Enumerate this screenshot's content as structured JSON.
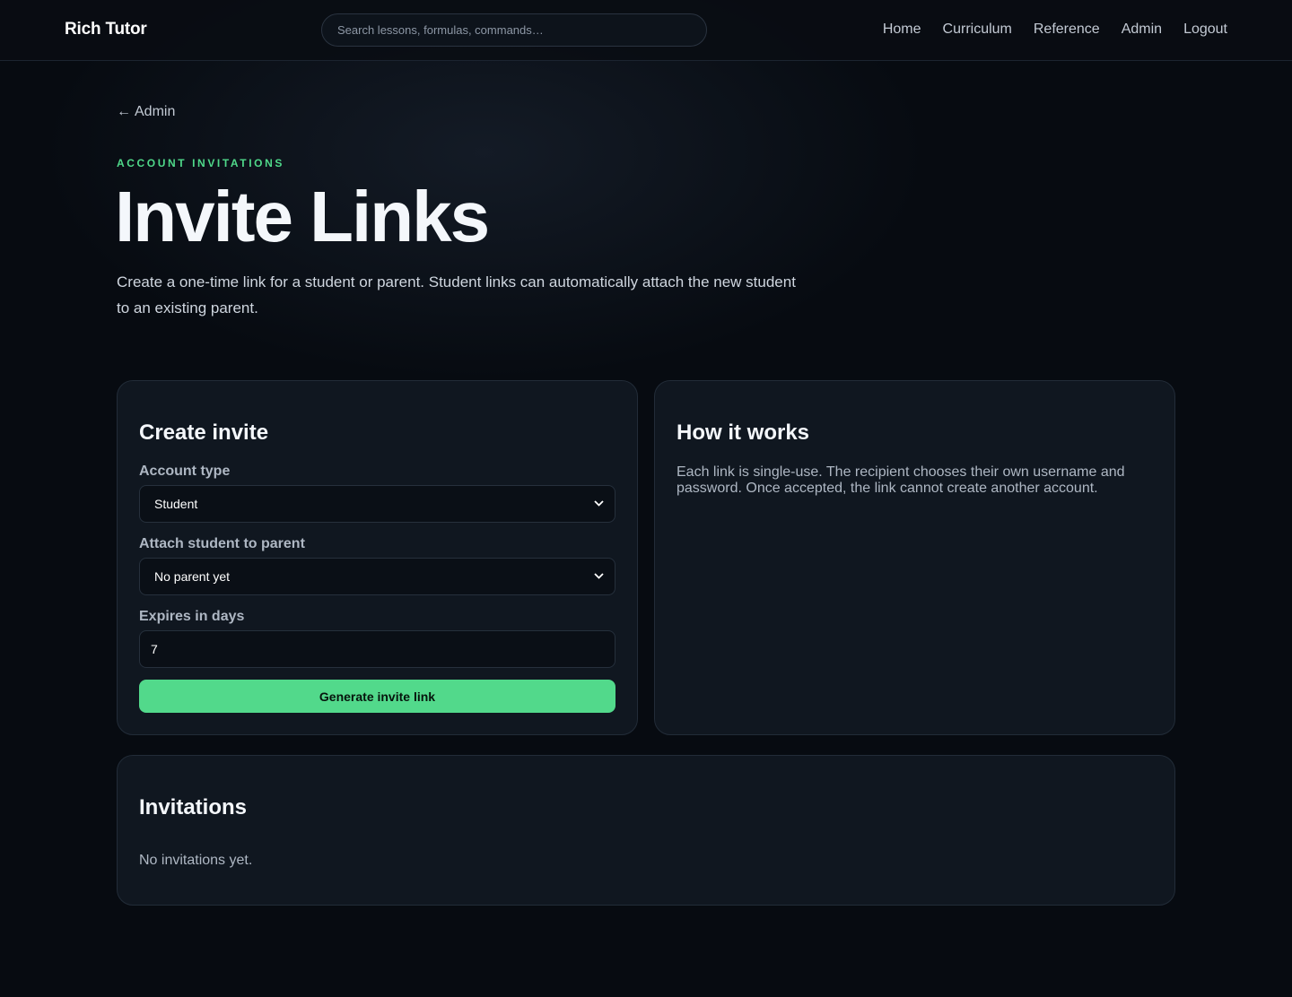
{
  "header": {
    "brand": "Rich Tutor",
    "search_placeholder": "Search lessons, formulas, commands…",
    "nav": [
      "Home",
      "Curriculum",
      "Reference",
      "Admin",
      "Logout"
    ]
  },
  "back_link": {
    "arrow": "←",
    "label": "Admin"
  },
  "hero": {
    "eyebrow": "ACCOUNT INVITATIONS",
    "title": "Invite Links",
    "description": "Create a one-time link for a student or parent. Student links can automatically attach the new student to an existing parent."
  },
  "create_invite": {
    "heading": "Create invite",
    "account_type_label": "Account type",
    "account_type_value": "Student",
    "parent_label": "Attach student to parent",
    "parent_value": "No parent yet",
    "expires_label": "Expires in days",
    "expires_value": "7",
    "submit_label": "Generate invite link"
  },
  "how_it_works": {
    "heading": "How it works",
    "text": "Each link is single-use. The recipient chooses their own username and password. Once accepted, the link cannot create another account."
  },
  "invitations": {
    "heading": "Invitations",
    "empty_text": "No invitations yet."
  },
  "colors": {
    "accent": "#52d98b",
    "background": "#070b11",
    "card": "#101720"
  }
}
